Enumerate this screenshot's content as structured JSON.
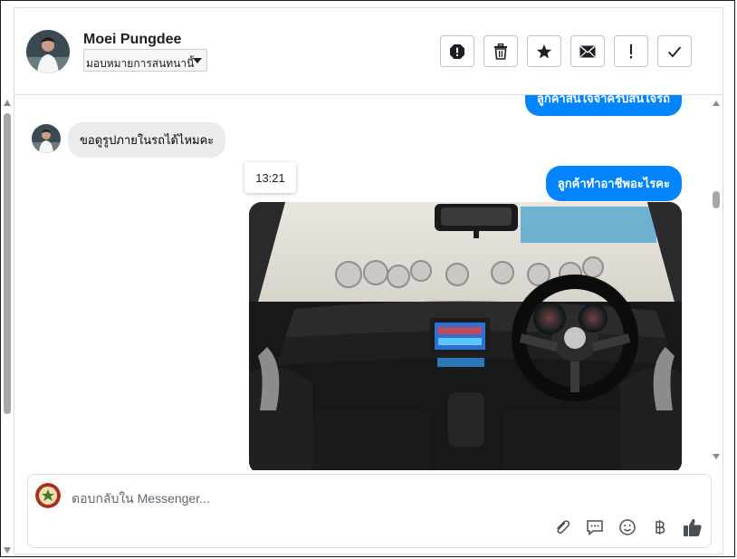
{
  "header": {
    "contact_name": "Moei Pungdee",
    "assign_label": "มอบหมายการสนทนานี้"
  },
  "conversation": {
    "partial_message_top": "ลูกค้าสนใจจำครับสนใจรถ",
    "incoming_message": "ขอดูรูปภายในรถได้ไหมคะ",
    "timestamp": "13:21",
    "outgoing_message": "ลูกค้าทำอาชีพอะไรคะ",
    "photo_description_icon": "car-interior-photo"
  },
  "composer": {
    "placeholder": "ตอบกลับใน Messenger..."
  },
  "colors": {
    "accent": "#0084ff",
    "incoming_bubble": "#eaebed"
  }
}
